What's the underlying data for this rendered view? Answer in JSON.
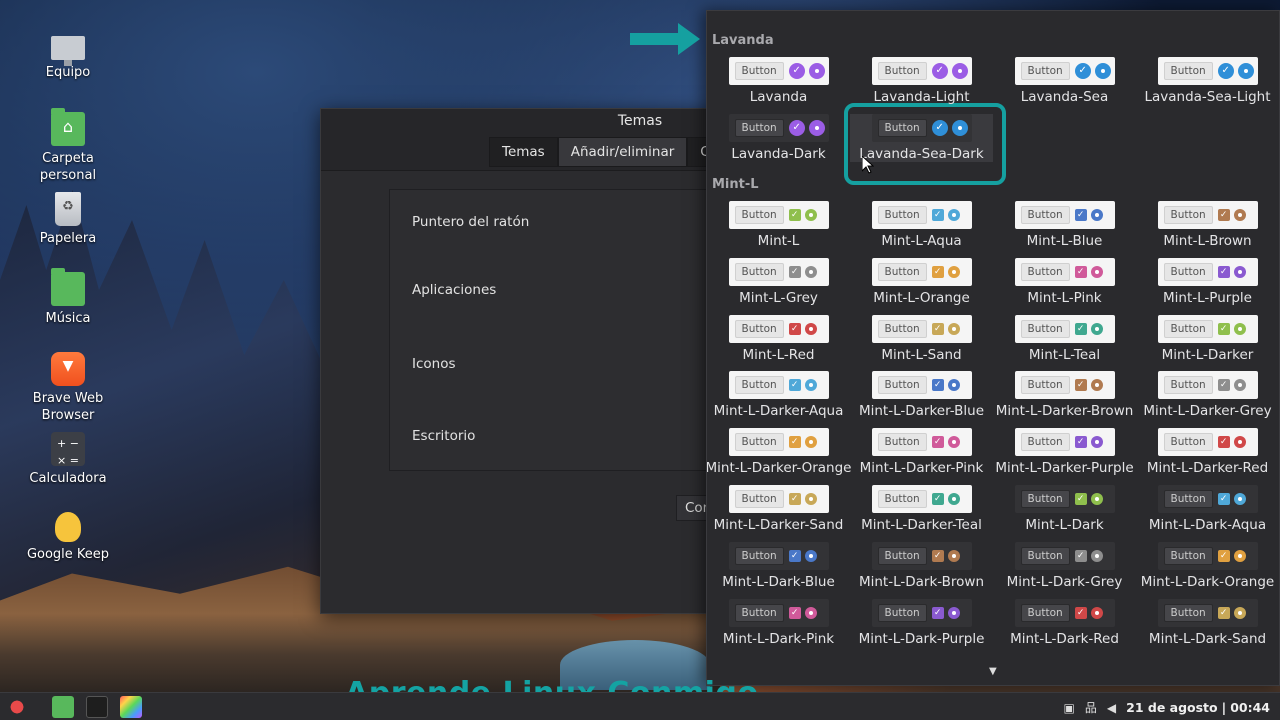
{
  "desktop": {
    "icons": [
      {
        "label": "Equipo",
        "icon": "monitor-icon"
      },
      {
        "label": "Carpeta personal",
        "icon": "home-folder-icon"
      },
      {
        "label": "Papelera",
        "icon": "trash-icon"
      },
      {
        "label": "Música",
        "icon": "music-folder-icon"
      },
      {
        "label": "Brave Web Browser",
        "icon": "brave-icon"
      },
      {
        "label": "Calculadora",
        "icon": "calculator-icon"
      },
      {
        "label": "Google Keep",
        "icon": "keep-bulb-icon"
      }
    ]
  },
  "temas": {
    "title": "Temas",
    "tabs": [
      "Temas",
      "Añadir/eliminar",
      "Co"
    ],
    "rows": [
      "Puntero del ratón",
      "Aplicaciones",
      "Iconos",
      "Escritorio"
    ],
    "button": "Con"
  },
  "chooser": {
    "sections": [
      {
        "label": "Lavanda",
        "themes": [
          {
            "name": "Lavanda",
            "style": "light",
            "accent": "#9b5de5"
          },
          {
            "name": "Lavanda-Light",
            "style": "light",
            "accent": "#9b5de5"
          },
          {
            "name": "Lavanda-Sea",
            "style": "light",
            "accent": "#2f8fd8"
          },
          {
            "name": "Lavanda-Sea-Light",
            "style": "light",
            "accent": "#2f8fd8"
          },
          {
            "name": "Lavanda-Dark",
            "style": "dark",
            "accent": "#9b5de5"
          },
          {
            "name": "Lavanda-Sea-Dark",
            "style": "dark",
            "accent": "#2f8fd8",
            "selected": true
          }
        ]
      },
      {
        "label": "Mint-L",
        "themes": [
          {
            "name": "Mint-L",
            "style": "light",
            "accent": "#8fbf4d"
          },
          {
            "name": "Mint-L-Aqua",
            "style": "light",
            "accent": "#4fa8d8"
          },
          {
            "name": "Mint-L-Blue",
            "style": "light",
            "accent": "#4a78c8"
          },
          {
            "name": "Mint-L-Brown",
            "style": "light",
            "accent": "#b07a50"
          },
          {
            "name": "Mint-L-Grey",
            "style": "light",
            "accent": "#8e8e8e"
          },
          {
            "name": "Mint-L-Orange",
            "style": "light",
            "accent": "#e0a040"
          },
          {
            "name": "Mint-L-Pink",
            "style": "light",
            "accent": "#d05a9a"
          },
          {
            "name": "Mint-L-Purple",
            "style": "light",
            "accent": "#8a5ad0"
          },
          {
            "name": "Mint-L-Red",
            "style": "light",
            "accent": "#d04848"
          },
          {
            "name": "Mint-L-Sand",
            "style": "light",
            "accent": "#c8a858"
          },
          {
            "name": "Mint-L-Teal",
            "style": "light",
            "accent": "#40a890"
          },
          {
            "name": "Mint-L-Darker",
            "style": "light",
            "accent": "#8fbf4d"
          },
          {
            "name": "Mint-L-Darker-Aqua",
            "style": "light",
            "accent": "#4fa8d8"
          },
          {
            "name": "Mint-L-Darker-Blue",
            "style": "light",
            "accent": "#4a78c8"
          },
          {
            "name": "Mint-L-Darker-Brown",
            "style": "light",
            "accent": "#b07a50"
          },
          {
            "name": "Mint-L-Darker-Grey",
            "style": "light",
            "accent": "#8e8e8e"
          },
          {
            "name": "Mint-L-Darker-Orange",
            "style": "light",
            "accent": "#e0a040"
          },
          {
            "name": "Mint-L-Darker-Pink",
            "style": "light",
            "accent": "#d05a9a"
          },
          {
            "name": "Mint-L-Darker-Purple",
            "style": "light",
            "accent": "#8a5ad0"
          },
          {
            "name": "Mint-L-Darker-Red",
            "style": "light",
            "accent": "#d04848"
          },
          {
            "name": "Mint-L-Darker-Sand",
            "style": "light",
            "accent": "#c8a858"
          },
          {
            "name": "Mint-L-Darker-Teal",
            "style": "light",
            "accent": "#40a890"
          },
          {
            "name": "Mint-L-Dark",
            "style": "dark",
            "accent": "#8fbf4d"
          },
          {
            "name": "Mint-L-Dark-Aqua",
            "style": "dark",
            "accent": "#4fa8d8"
          },
          {
            "name": "Mint-L-Dark-Blue",
            "style": "dark",
            "accent": "#4a78c8"
          },
          {
            "name": "Mint-L-Dark-Brown",
            "style": "dark",
            "accent": "#b07a50"
          },
          {
            "name": "Mint-L-Dark-Grey",
            "style": "dark",
            "accent": "#8e8e8e"
          },
          {
            "name": "Mint-L-Dark-Orange",
            "style": "dark",
            "accent": "#e0a040"
          },
          {
            "name": "Mint-L-Dark-Pink",
            "style": "dark",
            "accent": "#d05a9a"
          },
          {
            "name": "Mint-L-Dark-Purple",
            "style": "dark",
            "accent": "#8a5ad0"
          },
          {
            "name": "Mint-L-Dark-Red",
            "style": "dark",
            "accent": "#d04848"
          },
          {
            "name": "Mint-L-Dark-Sand",
            "style": "dark",
            "accent": "#c8a858"
          }
        ]
      }
    ],
    "preview_button": "Button"
  },
  "watermark": "Aprende Linux Conmigo",
  "taskbar": {
    "date": "21 de agosto",
    "time": "00:44",
    "separator": "|"
  }
}
